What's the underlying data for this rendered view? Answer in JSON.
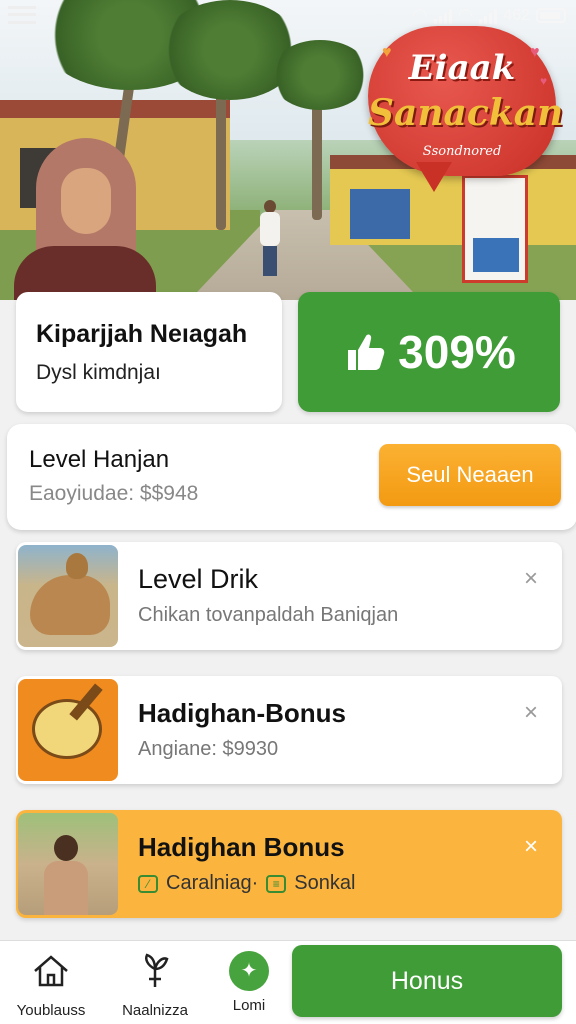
{
  "status": {
    "signal_text": "462"
  },
  "brand": {
    "line1": "Eiaak",
    "line2": "Sanackan",
    "line3": "Ssondnored"
  },
  "profile": {
    "name": "Kiparjjah Neıagah",
    "subtitle": "Dysl kimdnjaı"
  },
  "stat": {
    "value": "309%",
    "icon": "thumbs-up-icon",
    "color": "#3f9c36"
  },
  "level": {
    "title": "Level Hanjan",
    "subtitle": "Eaoyiudae: $$948",
    "button_label": "Seul Neaaen"
  },
  "list": [
    {
      "title": "Level Drik",
      "subtitle": "Chikan tovanpaldah Baniqjan",
      "close": "×"
    },
    {
      "title": "Hadighan-Bonus",
      "subtitle": "Angiane: $9930",
      "close": "×"
    },
    {
      "title": "Hadighan Bonus",
      "tag1": "Caralniag·",
      "tag2": "Sonkal",
      "close": "×"
    }
  ],
  "nav": {
    "items": [
      {
        "label": "Youblauss",
        "icon": "home-icon"
      },
      {
        "label": "Naalnizza",
        "icon": "plant-icon"
      },
      {
        "label": "Lomi",
        "icon": "sparkle-icon"
      }
    ],
    "cta_label": "Honus"
  },
  "colors": {
    "accent_green": "#3f9c36",
    "accent_orange": "#f39a12",
    "highlight_yellow": "#fbb53f",
    "brand_red": "#c93026"
  }
}
